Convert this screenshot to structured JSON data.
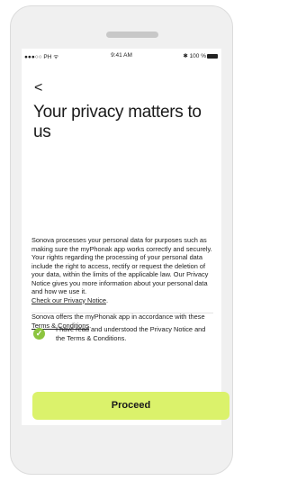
{
  "status_bar": {
    "carrier": "●●●○○ PH ᯤ",
    "time": "9:41 AM",
    "battery": "✱ 100 %"
  },
  "nav": {
    "back_icon": "chevron-left-icon",
    "back_glyph": "<"
  },
  "page": {
    "title": "Your privacy matters to us",
    "paragraph1": "Sonova processes your personal data for purposes such as making sure the myPhonak app works correctly and securely. Your rights regarding the processing of your personal data include the right to access, rectify or request the deletion of your data, within the limits of the applicable law. Our Privacy Notice gives you more information about your personal data and how we use it.",
    "privacy_link": "Check our Privacy Notice",
    "paragraph2_prefix": "Sonova offers the myPhonak app in accordance with these ",
    "terms_link": "Terms & Conditions",
    "paragraph2_suffix": ".",
    "period": "."
  },
  "consent": {
    "checked": true,
    "check_glyph": "✓",
    "label": "I have read and understood the Privacy Notice and the Terms & Conditions."
  },
  "actions": {
    "proceed_label": "Proceed"
  },
  "colors": {
    "accent": "#dbf26b",
    "check": "#8cc43f"
  }
}
